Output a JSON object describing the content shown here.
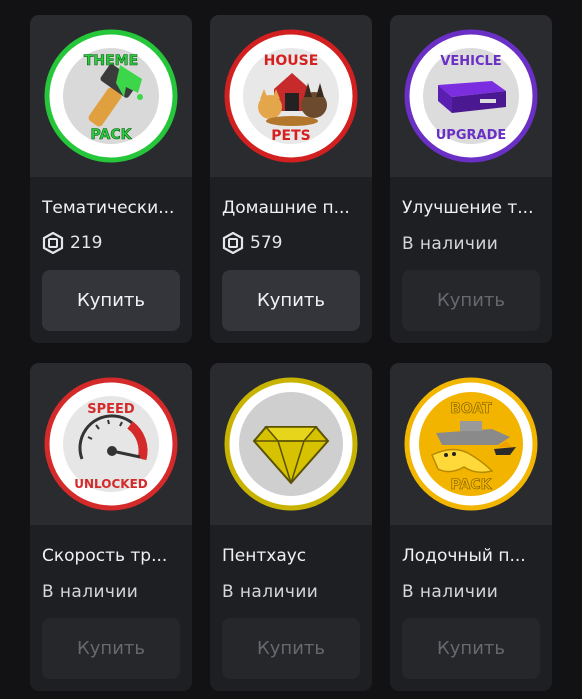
{
  "items": [
    {
      "name": "Тематически...",
      "badge_top": "THEME",
      "badge_bottom": "PACK",
      "price": "219",
      "button": "Купить",
      "accent": "#2ecc40"
    },
    {
      "name": "Домашние п...",
      "badge_top": "HOUSE",
      "badge_bottom": "PETS",
      "price": "579",
      "button": "Купить",
      "accent": "#d62020"
    },
    {
      "name": "Улучшение т...",
      "badge_top": "VEHICLE",
      "badge_bottom": "UPGRADE",
      "status": "В наличии",
      "button": "Купить",
      "accent": "#6a2fc4"
    },
    {
      "name": "Скорость тр...",
      "badge_top": "SPEED",
      "badge_bottom": "UNLOCKED",
      "status": "В наличии",
      "button": "Купить",
      "accent": "#d42a2a"
    },
    {
      "name": "Пентхаус",
      "status": "В наличии",
      "button": "Купить",
      "accent": "#c8b400"
    },
    {
      "name": "Лодочный п...",
      "badge_top": "BOAT",
      "badge_bottom": "PACK",
      "status": "В наличии",
      "button": "Купить",
      "accent": "#f2b600"
    }
  ],
  "icons": {
    "currency": "robux-icon"
  }
}
